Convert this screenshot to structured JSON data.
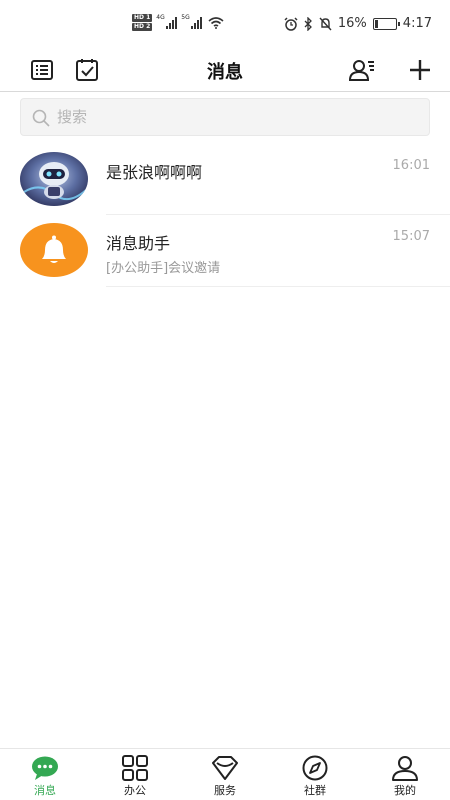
{
  "status_bar": {
    "hd1": "HD 1",
    "hd2": "HD 2",
    "sig1_label": "4G",
    "sig2_label": "5G",
    "battery_percent": "16%",
    "battery_level": 0.16,
    "time": "4:17"
  },
  "header": {
    "title": "消息"
  },
  "search": {
    "placeholder": "搜索",
    "value": ""
  },
  "chats": [
    {
      "name": "是张浪啊啊啊",
      "time": "16:01",
      "preview": ""
    },
    {
      "name": "消息助手",
      "time": "15:07",
      "preview": "[办公助手]会议邀请"
    }
  ],
  "tabs": [
    {
      "label": "消息",
      "icon": "chat-bubble-icon",
      "active": true
    },
    {
      "label": "办公",
      "icon": "grid-icon",
      "active": false
    },
    {
      "label": "服务",
      "icon": "diamond-icon",
      "active": false
    },
    {
      "label": "社群",
      "icon": "compass-icon",
      "active": false
    },
    {
      "label": "我的",
      "icon": "person-icon",
      "active": false
    }
  ],
  "colors": {
    "accent": "#34a853",
    "assistant_avatar": "#f7931e"
  }
}
